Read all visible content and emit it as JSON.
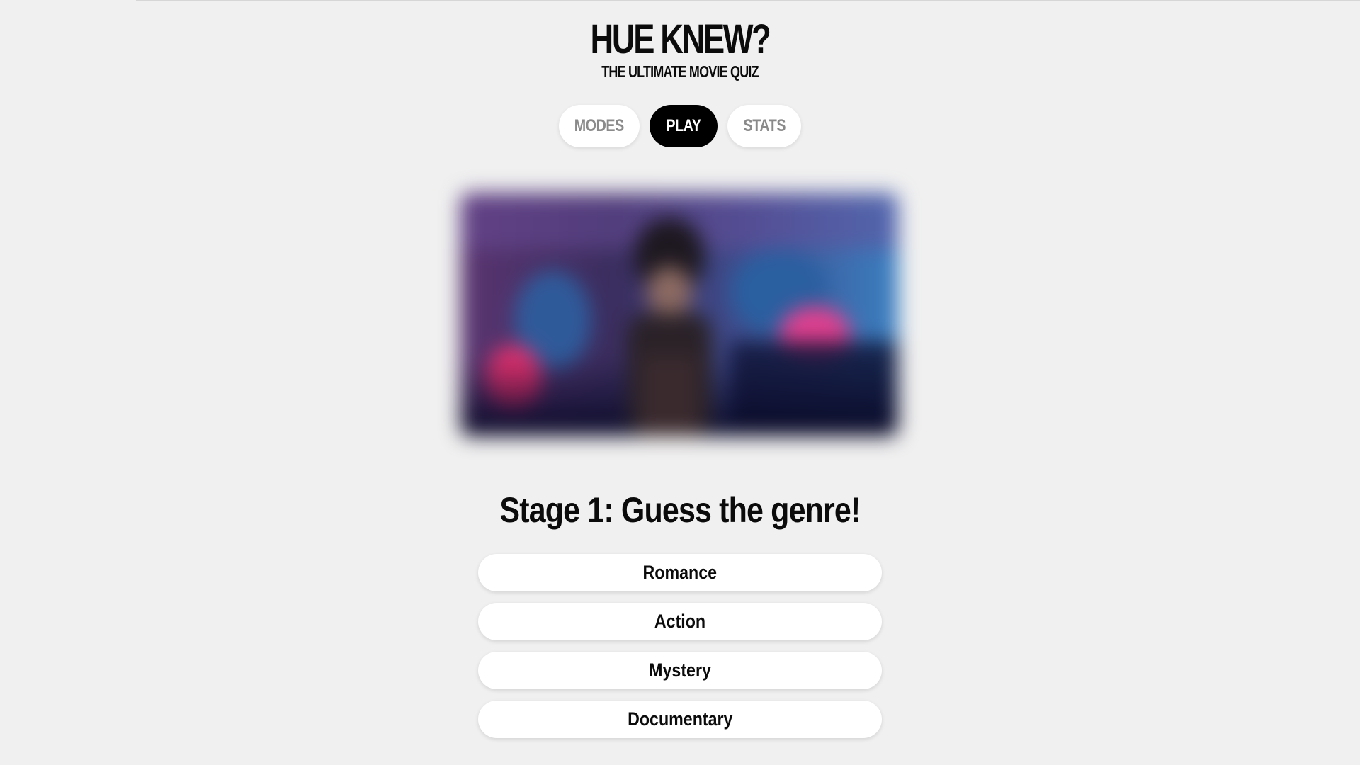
{
  "header": {
    "title": "HUE KNEW?",
    "subtitle": "THE ULTIMATE MOVIE QUIZ"
  },
  "nav": {
    "items": [
      {
        "label": "MODES",
        "active": false
      },
      {
        "label": "PLAY",
        "active": true
      },
      {
        "label": "STATS",
        "active": false
      }
    ]
  },
  "quiz": {
    "stage_title": "Stage 1: Guess the genre!",
    "options": [
      "Romance",
      "Action",
      "Mystery",
      "Documentary"
    ]
  },
  "colors": {
    "background": "#f0f0f0",
    "active_pill": "#000000",
    "pill": "#ffffff",
    "inactive_text": "#8a8a8a"
  }
}
